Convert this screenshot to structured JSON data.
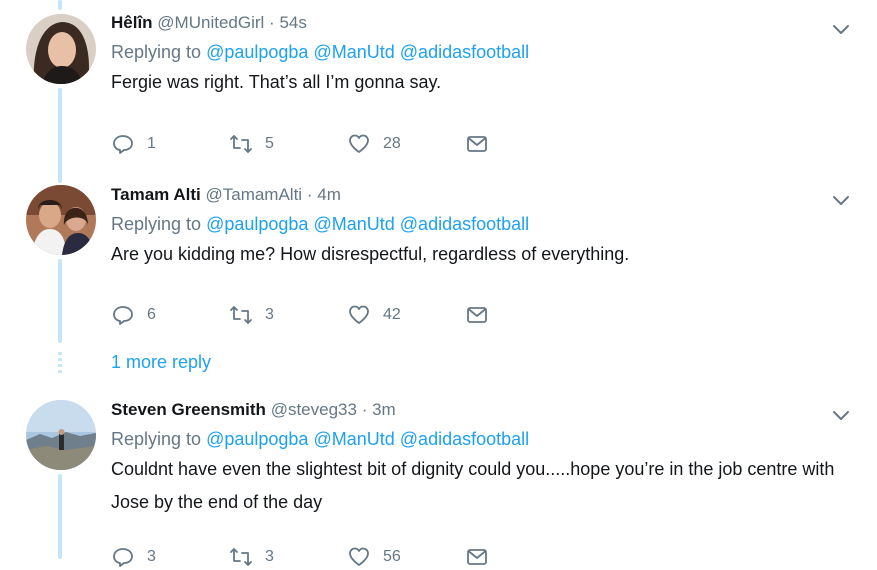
{
  "tweets": [
    {
      "name": "Hêlîn",
      "handle": "@MUnitedGirl",
      "dot": "·",
      "time": "54s",
      "replying_label": "Replying to",
      "mentions": [
        "@paulpogba",
        "@ManUtd",
        "@adidasfootball"
      ],
      "text": "Fergie was right. That’s all I’m gonna say.",
      "replies": "1",
      "retweets": "5",
      "likes": "28"
    },
    {
      "name": "Tamam Alti",
      "handle": "@TamamAlti",
      "dot": "·",
      "time": "4m",
      "replying_label": "Replying to",
      "mentions": [
        "@paulpogba",
        "@ManUtd",
        "@adidasfootball"
      ],
      "text": "Are you kidding me? How disrespectful, regardless of everything.",
      "replies": "6",
      "retweets": "3",
      "likes": "42"
    },
    {
      "name": "Steven Greensmith",
      "handle": "@steveg33",
      "dot": "·",
      "time": "3m",
      "replying_label": "Replying to",
      "mentions": [
        "@paulpogba",
        "@ManUtd",
        "@adidasfootball"
      ],
      "text": "Couldnt have even the slightest bit of dignity could you.....hope you’re in the job centre with Jose by the end of the day",
      "replies": "3",
      "retweets": "3",
      "likes": "56"
    }
  ],
  "more_reply": "1 more reply",
  "colors": {
    "link": "#1da1f2",
    "muted": "#657786",
    "thread": "#c4e6f6"
  },
  "icons": [
    "reply-icon",
    "retweet-icon",
    "like-icon",
    "message-icon",
    "chevron-down-icon"
  ]
}
